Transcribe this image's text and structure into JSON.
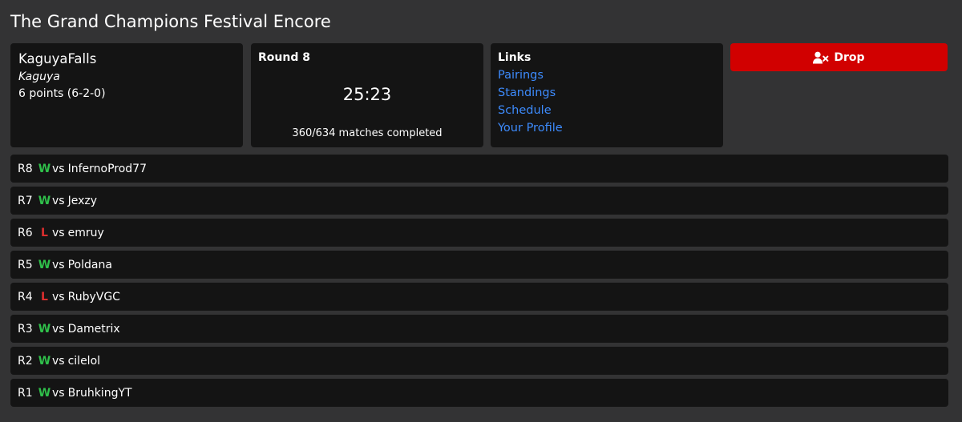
{
  "tournament": {
    "title": "The Grand Champions Festival Encore"
  },
  "player": {
    "name": "KaguyaFalls",
    "alias": "Kaguya",
    "points": "6 points (6-2-0)"
  },
  "round_info": {
    "label": "Round 8",
    "timer": "25:23",
    "matches_completed": "360/634 matches completed"
  },
  "links": {
    "label": "Links",
    "items": [
      {
        "label": "Pairings"
      },
      {
        "label": "Standings"
      },
      {
        "label": "Schedule"
      },
      {
        "label": "Your Profile"
      }
    ]
  },
  "drop_button": {
    "label": "Drop",
    "icon": "user-x-icon",
    "color": "#d10000"
  },
  "colors": {
    "win": "#2fbf4a",
    "loss": "#dc2e2e",
    "link": "#3d8bfd",
    "card_bg": "#141414",
    "page_bg": "#333334"
  },
  "rounds": [
    {
      "round": "R8",
      "result": "W",
      "vs": "vs",
      "opponent": "InfernoProd77"
    },
    {
      "round": "R7",
      "result": "W",
      "vs": "vs",
      "opponent": "Jexzy"
    },
    {
      "round": "R6",
      "result": "L",
      "vs": "vs",
      "opponent": "emruy"
    },
    {
      "round": "R5",
      "result": "W",
      "vs": "vs",
      "opponent": "Poldana"
    },
    {
      "round": "R4",
      "result": "L",
      "vs": "vs",
      "opponent": "RubyVGC"
    },
    {
      "round": "R3",
      "result": "W",
      "vs": "vs",
      "opponent": "Dametrix"
    },
    {
      "round": "R2",
      "result": "W",
      "vs": "vs",
      "opponent": "cilelol"
    },
    {
      "round": "R1",
      "result": "W",
      "vs": "vs",
      "opponent": "BruhkingYT"
    }
  ]
}
